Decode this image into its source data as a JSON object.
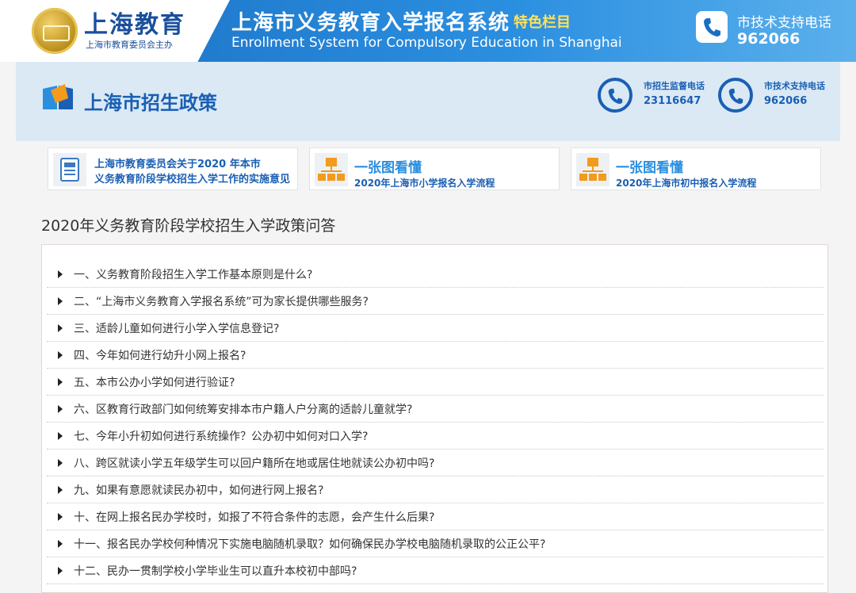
{
  "header": {
    "logo_title": "上海教育",
    "logo_subtitle": "上海市教育委员会主办",
    "system_title": "上海市义务教育入学报名系统",
    "system_tag": "特色栏目",
    "system_subtitle_en": "Enrollment System for Compulsory Education in Shanghai",
    "support_label": "市技术支持电话",
    "support_number": "962066",
    "icon": "phone-icon"
  },
  "banner": {
    "title": "上海市招生政策",
    "hotlines": [
      {
        "label": "市招生监督电话",
        "number": "23116647",
        "icon": "phone-bubble-icon"
      },
      {
        "label": "市技术支持电话",
        "number": "962066",
        "icon": "phone-bubble-icon"
      }
    ]
  },
  "cards": [
    {
      "line1": "上海市教育委员会关于2020 年本市",
      "line2": "义务教育阶段学校招生入学工作的实施意见",
      "icon": "document-icon"
    },
    {
      "big": "一张图看懂",
      "small": "2020年上海市小学报名入学流程",
      "icon": "flowchart-icon"
    },
    {
      "big": "一张图看懂",
      "small": "2020年上海市初中报名入学流程",
      "icon": "flowchart-icon"
    }
  ],
  "section_title": "2020年义务教育阶段学校招生入学政策问答",
  "faq": [
    "一、义务教育阶段招生入学工作基本原则是什么?",
    "二、“上海市义务教育入学报名系统”可为家长提供哪些服务?",
    "三、适龄儿童如何进行小学入学信息登记?",
    "四、今年如何进行幼升小网上报名?",
    "五、本市公办小学如何进行验证?",
    "六、区教育行政部门如何统筹安排本市户籍人户分离的适龄儿童就学?",
    "七、今年小升初如何进行系统操作？公办初中如何对口入学?",
    "八、跨区就读小学五年级学生可以回户籍所在地或居住地就读公办初中吗?",
    "九、如果有意愿就读民办初中，如何进行网上报名?",
    "十、在网上报名民办学校时，如报了不符合条件的志愿，会产生什么后果?",
    "十一、报名民办学校何种情况下实施电脑随机录取？如何确保民办学校电脑随机录取的公正公平?",
    "十二、民办一贯制学校小学毕业生可以直升本校初中部吗?"
  ]
}
